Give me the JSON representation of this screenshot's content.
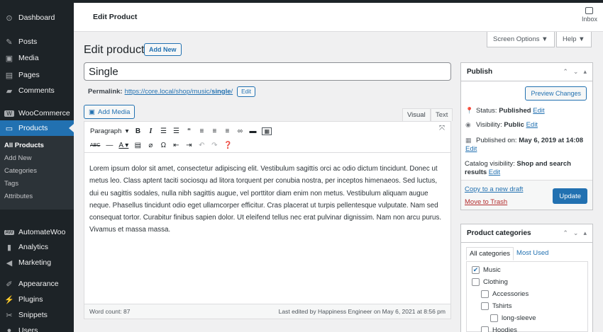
{
  "sidebar": {
    "items": [
      {
        "label": "Dashboard",
        "icon": "dashboard-icon",
        "glyph": "⊙"
      },
      {
        "label": "Posts",
        "icon": "pin-icon",
        "glyph": "✎"
      },
      {
        "label": "Media",
        "icon": "media-icon",
        "glyph": "▣"
      },
      {
        "label": "Pages",
        "icon": "pages-icon",
        "glyph": "▤"
      },
      {
        "label": "Comments",
        "icon": "comments-icon",
        "glyph": "▰"
      },
      {
        "label": "WooCommerce",
        "icon": "woocommerce-icon",
        "glyph": "W"
      },
      {
        "label": "Products",
        "icon": "products-icon",
        "glyph": "▭"
      },
      {
        "label": "AutomateWoo",
        "icon": "automatewoo-icon",
        "glyph": "AW"
      },
      {
        "label": "Analytics",
        "icon": "analytics-icon",
        "glyph": "▮"
      },
      {
        "label": "Marketing",
        "icon": "marketing-icon",
        "glyph": "◀"
      },
      {
        "label": "Appearance",
        "icon": "appearance-icon",
        "glyph": "✐"
      },
      {
        "label": "Plugins",
        "icon": "plugins-icon",
        "glyph": "⚡"
      },
      {
        "label": "Snippets",
        "icon": "snippets-icon",
        "glyph": "✂"
      },
      {
        "label": "Users",
        "icon": "users-icon",
        "glyph": "●"
      }
    ],
    "submenu": [
      "All Products",
      "Add New",
      "Categories",
      "Tags",
      "Attributes"
    ]
  },
  "header": {
    "title": "Edit Product",
    "inbox_label": "Inbox"
  },
  "screen_options": "Screen Options ▼",
  "help": "Help ▼",
  "page": {
    "title": "Edit product",
    "add_new": "Add New"
  },
  "product_title": "Single",
  "permalink": {
    "label": "Permalink:",
    "url_prefix": "https://core.local/shop/music/",
    "slug": "single",
    "url_suffix": "/",
    "edit": "Edit"
  },
  "editor": {
    "add_media": "Add Media",
    "tab_visual": "Visual",
    "tab_text": "Text",
    "format": "Paragraph",
    "content": "Lorem ipsum dolor sit amet, consectetur adipiscing elit. Vestibulum sagittis orci ac odio dictum tincidunt. Donec ut metus leo. Class aptent taciti sociosqu ad litora torquent per conubia nostra, per inceptos himenaeos. Sed luctus, dui eu sagittis sodales, nulla nibh sagittis augue, vel porttitor diam enim non metus. Vestibulum aliquam augue neque. Phasellus tincidunt odio eget ullamcorper efficitur. Cras placerat ut turpis pellentesque vulputate. Nam sed consequat tortor. Curabitur finibus sapien dolor. Ut eleifend tellus nec erat pulvinar dignissim. Nam non arcu purus. Vivamus et massa massa.",
    "word_count": "Word count: 87",
    "last_edited": "Last edited by Happiness Engineer on May 6, 2021 at 8:56 pm"
  },
  "publish": {
    "title": "Publish",
    "preview": "Preview Changes",
    "status_label": "Status:",
    "status_value": "Published",
    "visibility_label": "Visibility:",
    "visibility_value": "Public",
    "published_on_label": "Published on:",
    "published_on_value": "May 6, 2019 at 14:08",
    "catalog_label": "Catalog visibility:",
    "catalog_value": "Shop and search results",
    "edit": "Edit",
    "copy_draft": "Copy to a new draft",
    "trash": "Move to Trash",
    "update": "Update"
  },
  "categories": {
    "title": "Product categories",
    "tab_all": "All categories",
    "tab_used": "Most Used",
    "items": [
      {
        "label": "Music",
        "checked": true,
        "level": 0
      },
      {
        "label": "Clothing",
        "checked": false,
        "level": 0
      },
      {
        "label": "Accessories",
        "checked": false,
        "level": 1
      },
      {
        "label": "Tshirts",
        "checked": false,
        "level": 1
      },
      {
        "label": "long-sleeve",
        "checked": false,
        "level": 2
      },
      {
        "label": "Hoodies",
        "checked": false,
        "level": 1
      }
    ]
  },
  "colors": {
    "accent": "#2271b1",
    "sidebar": "#1d2327",
    "trash": "#b32d2e"
  }
}
